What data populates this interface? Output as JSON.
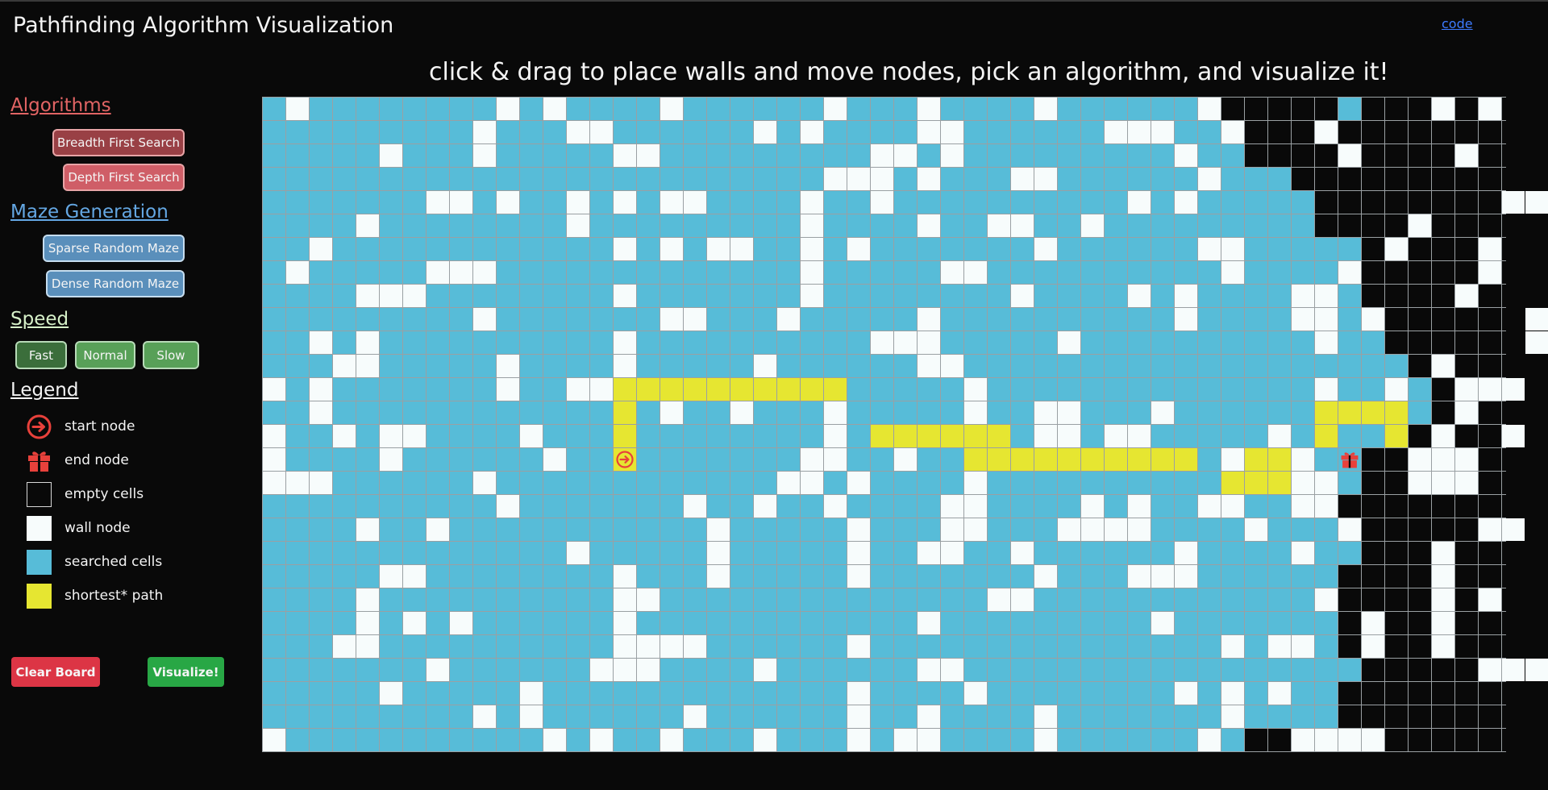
{
  "header": {
    "title": "Pathfinding Algorithm Visualization",
    "code_link": "code",
    "instructions": "click & drag to place walls and move nodes, pick an algorithm, and visualize it!"
  },
  "sidebar": {
    "algorithms": {
      "title": "Algorithms",
      "buttons": [
        "Breadth First Search",
        "Depth First Search"
      ]
    },
    "maze_generation": {
      "title": "Maze Generation",
      "buttons": [
        "Sparse Random Maze",
        "Dense Random Maze"
      ]
    },
    "speed": {
      "title": "Speed",
      "options": [
        "Fast",
        "Normal",
        "Slow"
      ],
      "selected": "Fast"
    },
    "legend": {
      "title": "Legend",
      "items": [
        {
          "icon": "start-node-icon",
          "label": "start node"
        },
        {
          "icon": "end-node-icon",
          "label": "end node"
        },
        {
          "icon": "empty-cell-swatch",
          "label": "empty cells"
        },
        {
          "icon": "wall-node-swatch",
          "label": "wall node"
        },
        {
          "icon": "searched-cell-swatch",
          "label": "searched cells"
        },
        {
          "icon": "shortest-path-swatch",
          "label": "shortest* path"
        }
      ]
    },
    "actions": {
      "clear": "Clear Board",
      "visualize": "Visualize!"
    }
  },
  "colors": {
    "searched": "#57bcd8",
    "wall": "#f7fcfc",
    "empty": "#090909",
    "path": "#e6e631",
    "node_icon": "#e8413b"
  },
  "grid": {
    "rows": 28,
    "cols": 55,
    "legend_codes": {
      "S": "searched",
      "W": "wall",
      "E": "empty",
      "P": "shortest path",
      "A": "start node",
      "B": "end node"
    },
    "cells": [
      "SWSSSSSSSSWSWSSSSWSSSSSSWSSSWSSSSWSSSSSSWEEEEESEEEWEWEE",
      "SSSSSSSSSWSSSWWSSSSSSWSWSSSSWWSSSSSSWWWSSWEEEWEEEEEEEEE",
      "SSSSSWSSSWSSSSSWWSSSSSSSSSWWSWSSSSSSSSSWSSEEEEWEEEEWEEE",
      "SSSSSSSSSSSSSSSSSSSSSSSSWWWSWSSSWWSSSSSSWSSSEEEEEEEEEEE",
      "SSSSSSSWWSWSSWSWSWWSSSSWSSWSSSSSSSSSSWSWSSSSSEEEEEEEEWW",
      "SSSSWSSSSSSSSWSSSSSSSSSWSSSSWSSWWSSWSSSSSSSSSEEEEWEEEEE",
      "SSWSSSSSSSSSSSSWSWSWWSSWSWSSSSSSSWSSSSSSWWSSSSSEWEEEWEE",
      "SWSSSSSWWWSSSSSSSSSSSSSWSSSSSWWSSSSSSSSSSWSSSSWEEEEEWEE",
      "SSSSWWWSSSSSSSSWSSSSSSSWSSSSSSSSWSSSSWSWSSSSWWSEEEEWEEE",
      "SSSSSSSSSWSSSSSSSWWSSSWSSSSSWSSSSSSSSSSWSSSSWWSWEEEEEEW",
      "SSWSWSSSSSSSSSSWSSSSSSSSSSWWWSSSSSWSSSSSSSSSSWSSEEEEEEW",
      "SSSWWSSSSSWSSSSWSSSSSWSSSSSSWWSSSSSSSSSSSSSSSSSSSEWEEEE",
      "WSWSSSSSSSWSSWWPPPPPPPPPPSSSSSWSSSSSSSSSSSSSSWSSWSEWWWE",
      "SSWSSSSSSSSSSSSPSWSSWSSSWSSSSSWSSWWSSSWSSSSSSPPPPSEWEEE",
      "WSSWSWWSSSSWSSSPSSSSSSSSWSPPPPPPSWWSWWSSSSSWSPSSPEWEEWE",
      "WSSSSWSSSSSSWSSASSSSSSSWWSSWSSPPPPPPPPPPSWPPWSBEEWWWEEE",
      "WWWSSSSSSWSSSSSSSSSSSSWWSWSSSSWSSSSSSSSSSPPPWWSEEWWWEEE",
      "SSSSSSSSSSWSSSSSSSWSSWSSWSSSSWWSSSSWSWSSWWSSWWEEEEEEEEE",
      "SSSSWSSWSSSSSSSSSSSWSSSSSWSSSWWSSSWWWWSSSSWSSSWEEEEEWWE",
      "SSSSSSSSSSSSSWSSSSSWSSSSSWSSWWSSWSSSSSSWSSSSWSSEEEWEEEE",
      "SSSSSWWSSSSSSSSWSSSWSSSSSWSSSSSSSWSSSWWWSSSSSSEEEEWEEEE",
      "SSSSWSSSSSSSSSSWWSSSSSSSSSSSSSSWWSSSSSSSSSSSSWEEEEWEWEE",
      "SSSSWSWSWSSSSSSWSSSSSSSSSSSSWSSSSSSSSSWSSSSSSSEWEEWEEEE",
      "SSSWWSSSSSSSSSSWWWWSSSSSSWSSSSSSSSSSSSSSSWSWWSEWEEWEEEE",
      "SSSSSSSWSSSSSSWWWSSSSWSSSSSSWWSSSSSSSSSSSSSSSSSEEEEEWWW",
      "SSSSSWSSSSSWSSSSSSSSSSSSSWSSSSWSSSSSSSSWSWSWSSEEEEEEEEE",
      "SSSSSSSSSWSWSSSSSSWSSSSSSWSSWSSSSWSSSSSSSWSSSSEEEEEEEEE",
      "WSSSSSSSSSSSWSWSSWSSSWSSSWSWWSSSSWSSSSSSWSEEWWWWEEEEEEE"
    ]
  }
}
